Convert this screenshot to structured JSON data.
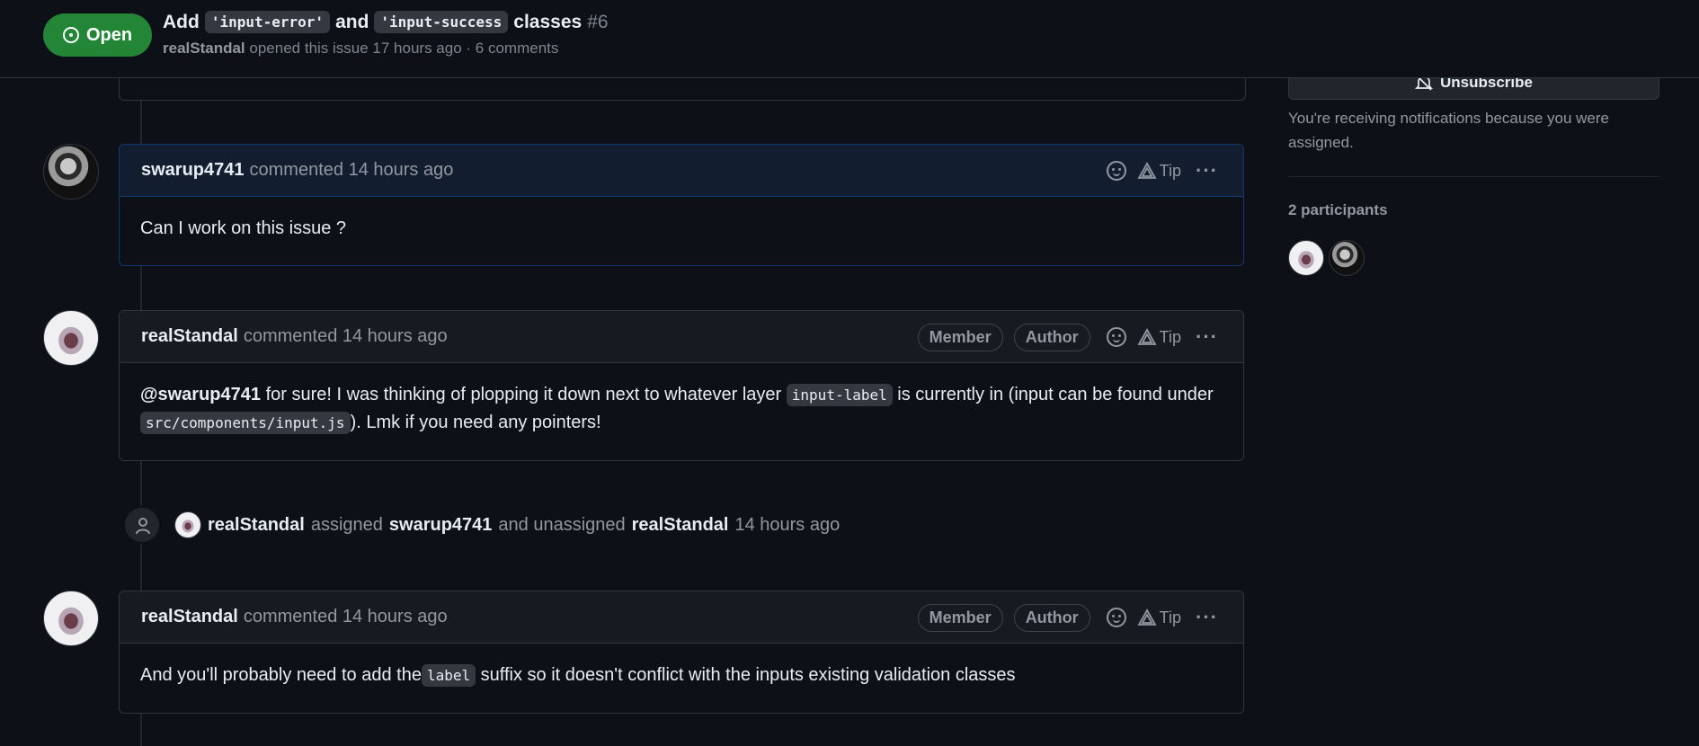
{
  "header": {
    "state_label": "Open",
    "title_prefix": "Add",
    "title_code1": "'input-error'",
    "title_mid": "and",
    "title_code2": "'input-success",
    "title_suffix": "classes",
    "issue_number": "#6",
    "opener": "realStandal",
    "opened_text": "opened this issue 17 hours ago · 6 comments"
  },
  "comments": [
    {
      "author": "swarup4741",
      "time": "commented 14 hours ago",
      "tip": "Tip",
      "body": "Can I work on this issue ?"
    },
    {
      "author": "realStandal",
      "time": "commented 14 hours ago",
      "badge_member": "Member",
      "badge_author": "Author",
      "tip": "Tip",
      "body_mention": "@swarup4741",
      "body_a": " for sure! I was thinking of plopping it down next to whatever layer ",
      "body_code1": "input-label",
      "body_b": " is currently in (input can be found under ",
      "body_code2": "src/components/input.js",
      "body_c": "). Lmk if you need any pointers!"
    },
    {
      "author": "realStandal",
      "time": "commented 14 hours ago",
      "badge_member": "Member",
      "badge_author": "Author",
      "tip": "Tip",
      "body_a": "And you'll probably need to add the",
      "body_code": "label",
      "body_b": " suffix so it doesn't conflict with the inputs existing validation classes"
    }
  ],
  "event": {
    "actor": "realStandal",
    "verb1": "assigned",
    "target1": "swarup4741",
    "verb2": "and unassigned",
    "target2": "realStandal",
    "time": "14 hours ago"
  },
  "sidebar": {
    "unsubscribe_label": "Unsubscribe",
    "notification_text": "You're receiving notifications because you were assigned.",
    "participants_label": "2 participants"
  },
  "icons": {
    "open": "issue-opened-icon",
    "emoji": "smiley-icon",
    "tip": "copilot-tip-icon",
    "more": "kebab-horizontal-icon",
    "person": "person-icon",
    "bell": "bell-slash-icon"
  },
  "colors": {
    "open_badge": "#238636",
    "background": "#0d1117",
    "highlight_border": "#1f6feb"
  }
}
